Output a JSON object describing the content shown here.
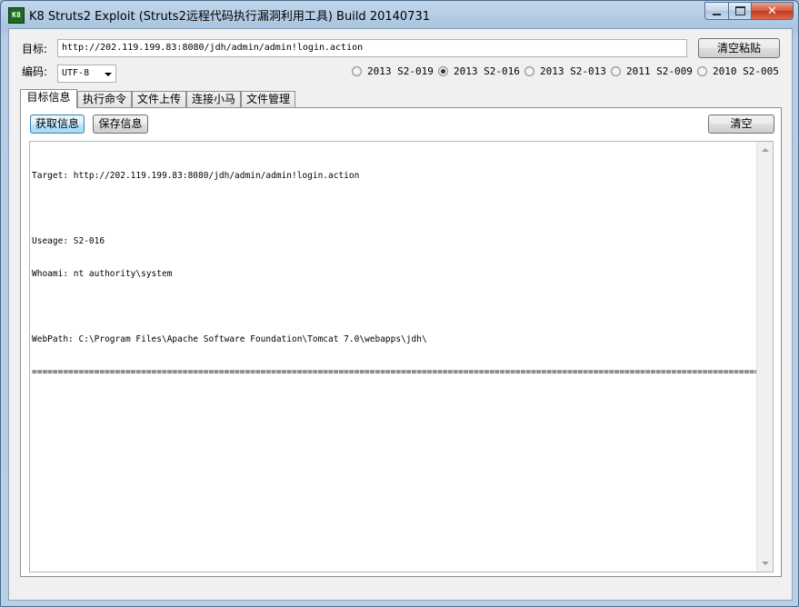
{
  "window": {
    "title": "K8 Struts2 Exploit (Struts2远程代码执行漏洞利用工具) Build 20140731",
    "icon_text": "K8",
    "close_glyph": "✕"
  },
  "target": {
    "label": "目标:",
    "value": "http://202.119.199.83:8080/jdh/admin/admin!login.action",
    "clear_paste_label": "清空粘贴"
  },
  "encoding": {
    "label": "编码:",
    "selected": "UTF-8"
  },
  "vulns": [
    {
      "label": "2013 S2-019",
      "checked": false
    },
    {
      "label": "2013 S2-016",
      "checked": true
    },
    {
      "label": "2013 S2-013",
      "checked": false
    },
    {
      "label": "2011 S2-009",
      "checked": false
    },
    {
      "label": "2010 S2-005",
      "checked": false
    }
  ],
  "tabs": [
    {
      "label": "目标信息",
      "active": true
    },
    {
      "label": "执行命令",
      "active": false
    },
    {
      "label": "文件上传",
      "active": false
    },
    {
      "label": "连接小马",
      "active": false
    },
    {
      "label": "文件管理",
      "active": false
    }
  ],
  "panel": {
    "get_info_label": "获取信息",
    "save_info_label": "保存信息",
    "clear_label": "清空"
  },
  "output": {
    "target_line": "Target: http://202.119.199.83:8080/jdh/admin/admin!login.action",
    "useage_line": "Useage: S2-016",
    "whoami_line": "Whoami: nt authority\\system",
    "webpath_line": "WebPath: C:\\Program Files\\Apache Software Foundation\\Tomcat 7.0\\webapps\\jdh\\",
    "rule_line": "==============================================================================================================================================="
  },
  "colors": {
    "titlebar": "#a9c4df",
    "client_bg": "#f0f0f0",
    "close_button": "#c2381d"
  }
}
